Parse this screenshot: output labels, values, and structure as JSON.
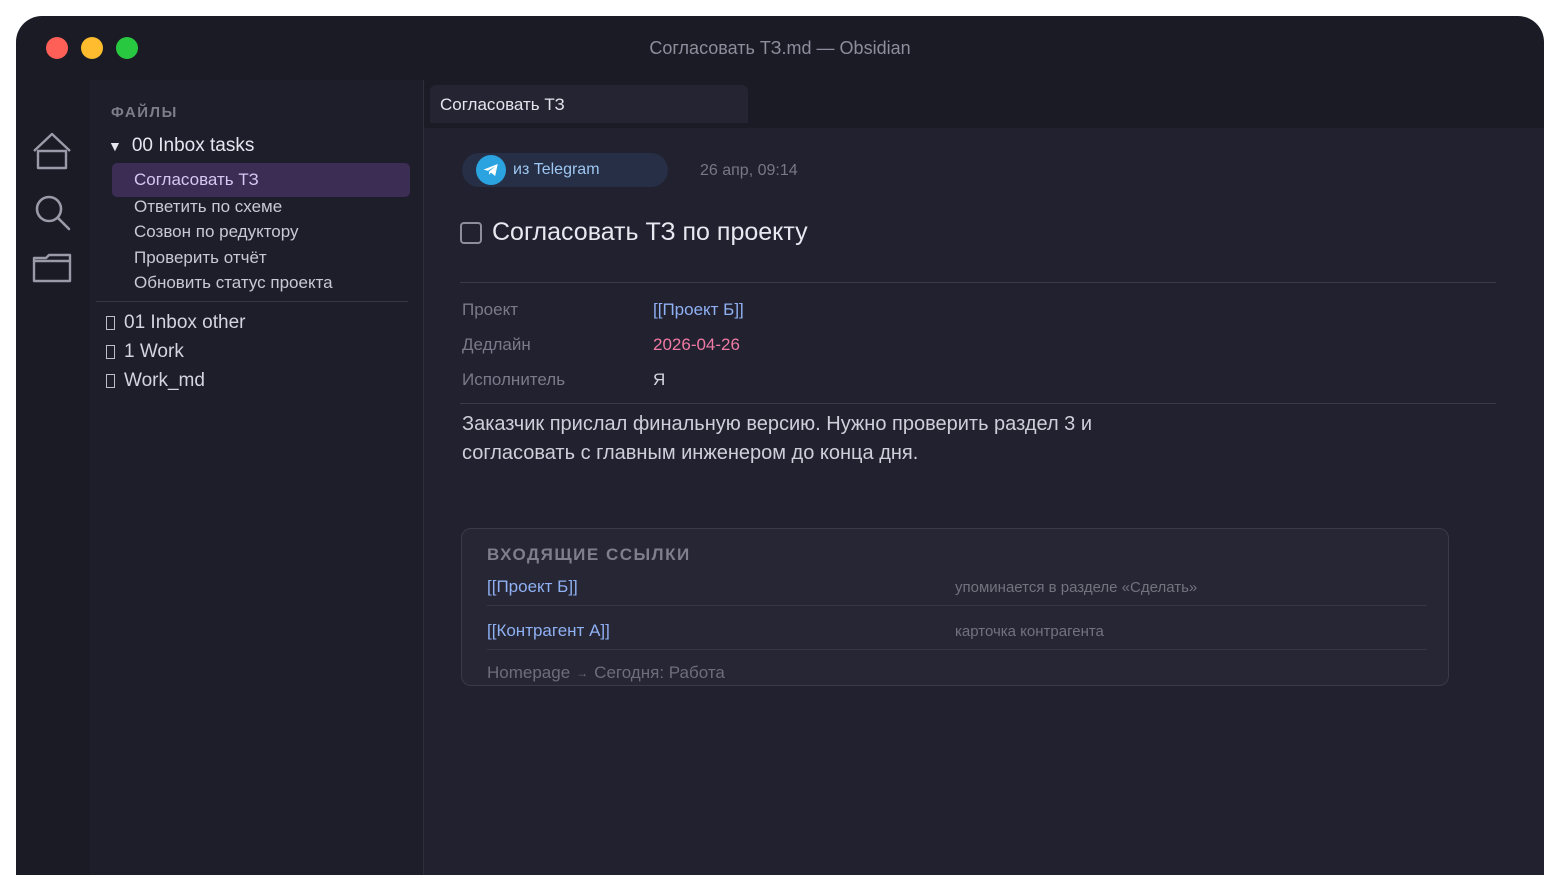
{
  "window": {
    "title": "Согласовать ТЗ.md — Obsidian"
  },
  "ribbon": {
    "icons": [
      "home-icon",
      "search-icon",
      "folder-icon"
    ]
  },
  "sidebar": {
    "heading": "ФАЙЛЫ",
    "open_folder": "00 Inbox tasks",
    "files": [
      {
        "label": "Согласовать ТЗ",
        "active": true
      },
      {
        "label": "Ответить по схеме",
        "active": false
      },
      {
        "label": "Созвон по редуктору",
        "active": false
      },
      {
        "label": "Проверить отчёт",
        "active": false
      },
      {
        "label": "Обновить статус проекта",
        "active": false
      }
    ],
    "folders": [
      {
        "label": "01 Inbox other"
      },
      {
        "label": "1 Work"
      },
      {
        "label": "Work_md"
      }
    ]
  },
  "tab": {
    "label": "Согласовать ТЗ"
  },
  "note": {
    "source_label": "из Telegram",
    "timestamp": "26 апр, 09:14",
    "title": "Согласовать ТЗ по проекту",
    "properties": [
      {
        "key": "Проект",
        "value": "[[Проект Б]]",
        "kind": "link"
      },
      {
        "key": "Дедлайн",
        "value": "2026-04-26",
        "kind": "date"
      },
      {
        "key": "Исполнитель",
        "value": "Я",
        "kind": "plain"
      }
    ],
    "body_line1": "Заказчик прислал финальную версию. Нужно проверить раздел 3 и",
    "body_line2": "согласовать с главным инженером до конца дня."
  },
  "backlinks": {
    "heading": "ВХОДЯЩИЕ ССЫЛКИ",
    "items": [
      {
        "link": "[[Проект Б]]",
        "note": "упоминается в разделе «Сделать»"
      },
      {
        "link": "[[Контрагент А]]",
        "note": "карточка контрагента"
      }
    ],
    "breadcrumb_from": "Homepage",
    "breadcrumb_arrow": "→",
    "breadcrumb_to": "Сегодня: Работа"
  },
  "colors": {
    "accent_active": "#3b2d54",
    "link": "#8fb0f2",
    "date": "#ef7aa3",
    "telegram": "#2aa3e0"
  }
}
